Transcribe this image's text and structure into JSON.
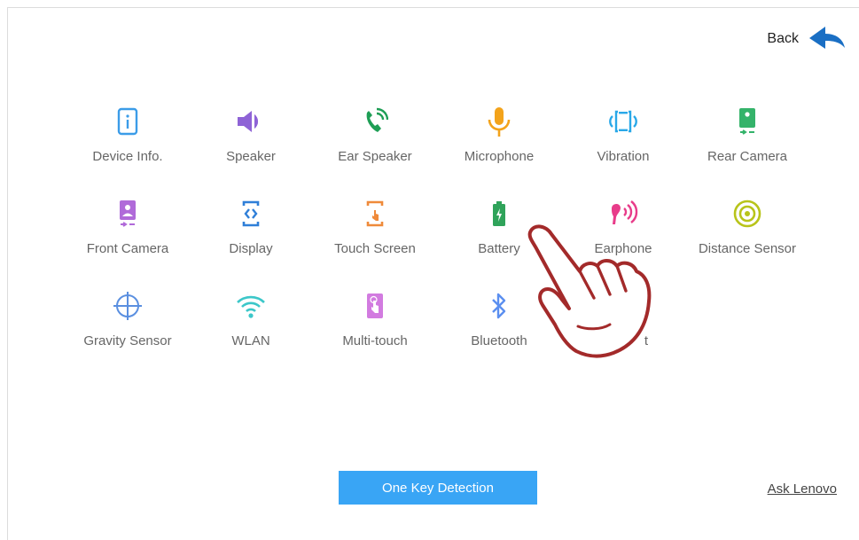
{
  "header": {
    "back_label": "Back"
  },
  "tiles": [
    {
      "label": "Device Info.",
      "icon": "device-info-icon",
      "color": "#3b9ce8"
    },
    {
      "label": "Speaker",
      "icon": "speaker-icon",
      "color": "#8e63d6"
    },
    {
      "label": "Ear Speaker",
      "icon": "ear-speaker-icon",
      "color": "#1e9e55"
    },
    {
      "label": "Microphone",
      "icon": "microphone-icon",
      "color": "#f3a31b"
    },
    {
      "label": "Vibration",
      "icon": "vibration-icon",
      "color": "#29a8e8"
    },
    {
      "label": "Rear Camera",
      "icon": "rear-camera-icon",
      "color": "#34b36a"
    },
    {
      "label": "Front Camera",
      "icon": "front-camera-icon",
      "color": "#b06ad9"
    },
    {
      "label": "Display",
      "icon": "display-icon",
      "color": "#2f7fd8"
    },
    {
      "label": "Touch Screen",
      "icon": "touch-screen-icon",
      "color": "#ef8a3a"
    },
    {
      "label": "Battery",
      "icon": "battery-icon",
      "color": "#2fa35a"
    },
    {
      "label": "Earphone",
      "icon": "earphone-icon",
      "color": "#e83c8a"
    },
    {
      "label": "Distance Sensor",
      "icon": "distance-sensor-icon",
      "color": "#b8c41a"
    },
    {
      "label": "Gravity Sensor",
      "icon": "gravity-sensor-icon",
      "color": "#5a8fe0"
    },
    {
      "label": "WLAN",
      "icon": "wlan-icon",
      "color": "#3cc7c9"
    },
    {
      "label": "Multi-touch",
      "icon": "multi-touch-icon",
      "color": "#d27be0"
    },
    {
      "label": "Bluetooth",
      "icon": "bluetooth-icon",
      "color": "#5b8ff0"
    },
    {
      "label": "t",
      "icon": "",
      "color": "#666666"
    }
  ],
  "footer": {
    "one_key_label": "One Key Detection",
    "ask_label": "Ask Lenovo"
  },
  "colors": {
    "accent": "#39a5f5",
    "back_arrow": "#1a6fc4",
    "hand_outline": "#a32a2a"
  }
}
